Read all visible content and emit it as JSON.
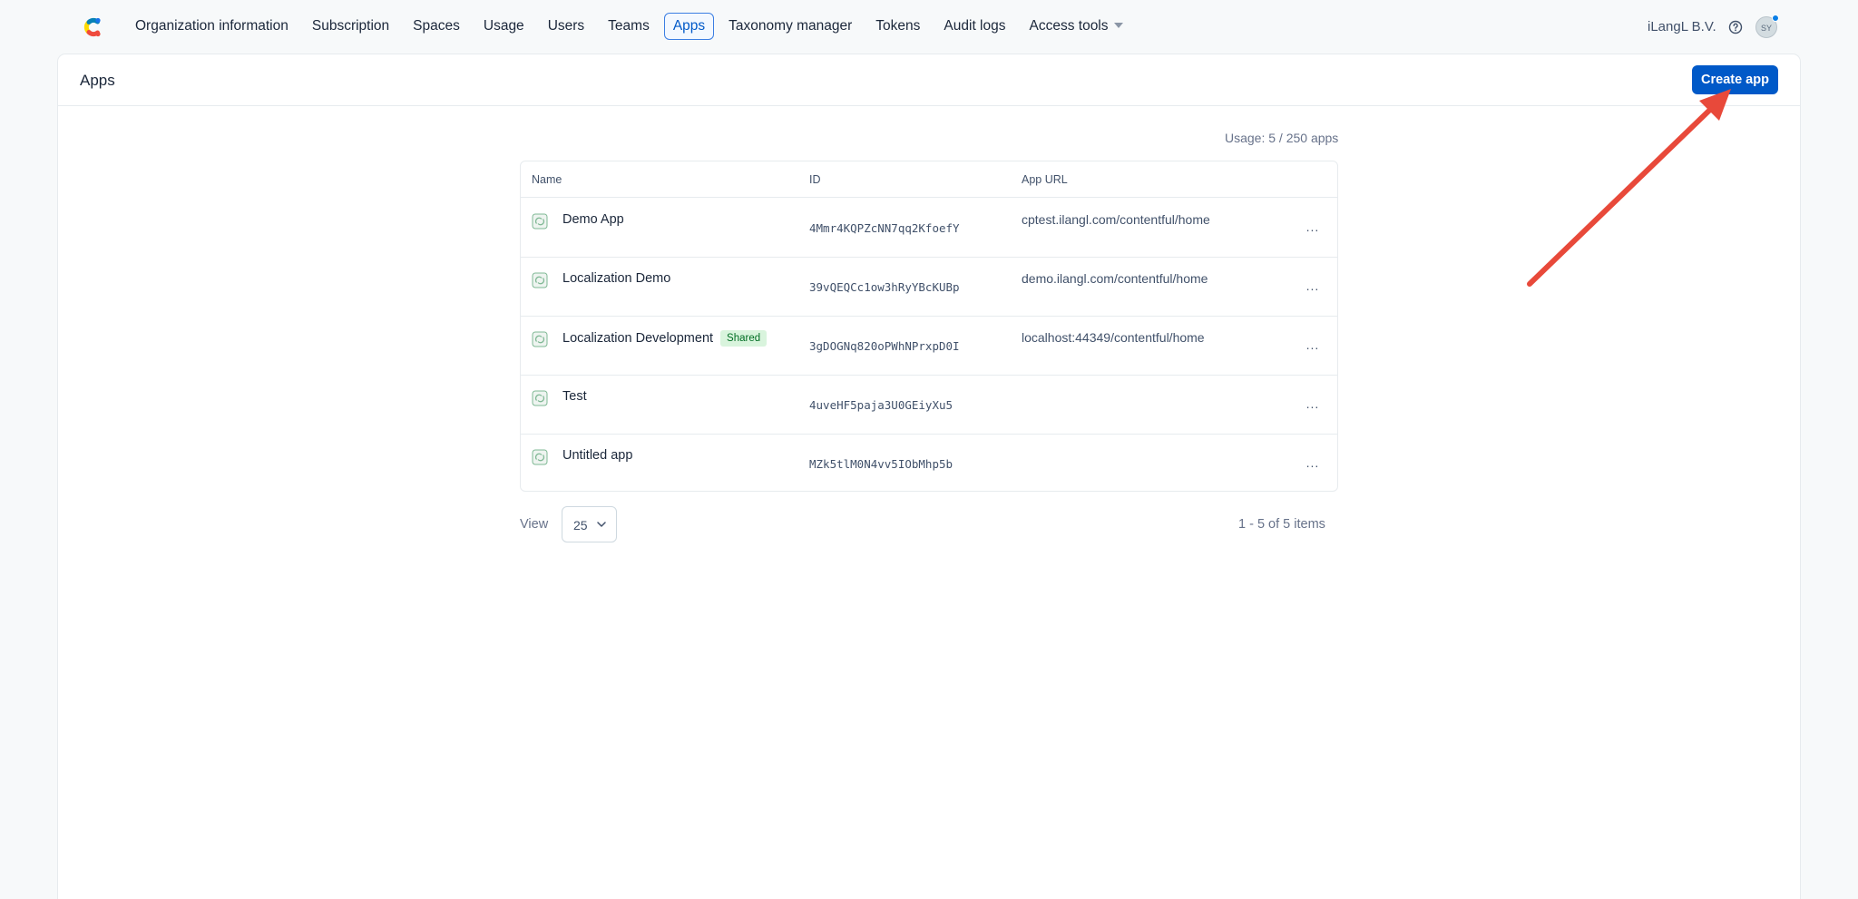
{
  "nav": {
    "items": [
      {
        "label": "Organization information",
        "active": false
      },
      {
        "label": "Subscription",
        "active": false
      },
      {
        "label": "Spaces",
        "active": false
      },
      {
        "label": "Usage",
        "active": false
      },
      {
        "label": "Users",
        "active": false
      },
      {
        "label": "Teams",
        "active": false
      },
      {
        "label": "Apps",
        "active": true
      },
      {
        "label": "Taxonomy manager",
        "active": false
      },
      {
        "label": "Tokens",
        "active": false
      },
      {
        "label": "Audit logs",
        "active": false
      },
      {
        "label": "Access tools",
        "active": false
      }
    ],
    "org_name": "iLangL B.V.",
    "avatar_initials": "SY"
  },
  "page": {
    "title": "Apps",
    "create_label": "Create app",
    "usage": "Usage: 5 / 250 apps"
  },
  "table": {
    "headers": {
      "name": "Name",
      "id": "ID",
      "url": "App URL"
    },
    "rows": [
      {
        "name": "Demo App",
        "badge": "",
        "id": "4Mmr4KQPZcNN7qq2KfoefY",
        "url": "cptest.ilangl.com/contentful/home"
      },
      {
        "name": "Localization Demo",
        "badge": "",
        "id": "39vQEQCc1ow3hRyYBcKUBp",
        "url": "demo.ilangl.com/contentful/home"
      },
      {
        "name": "Localization Development",
        "badge": "Shared",
        "id": "3gDOGNq820oPWhNPrxpD0I",
        "url": "localhost:44349/contentful/home"
      },
      {
        "name": "Test",
        "badge": "",
        "id": "4uveHF5paja3U0GEiyXu5",
        "url": ""
      },
      {
        "name": "Untitled app",
        "badge": "",
        "id": "MZk5tlM0N4vv5IObMhp5b",
        "url": ""
      }
    ],
    "more_label": "..."
  },
  "pagination": {
    "view_label": "View",
    "page_size": "25",
    "info": "1 - 5 of 5 items"
  },
  "colors": {
    "accent": "#0059c8",
    "annotation_arrow": "#e8493a",
    "badge_bg": "#d9f4dd",
    "badge_text": "#006d23"
  },
  "icons": [
    "contentful-logo-icon",
    "caret-down-icon",
    "help-icon",
    "app-icon",
    "more-icon",
    "chevron-down-icon"
  ]
}
